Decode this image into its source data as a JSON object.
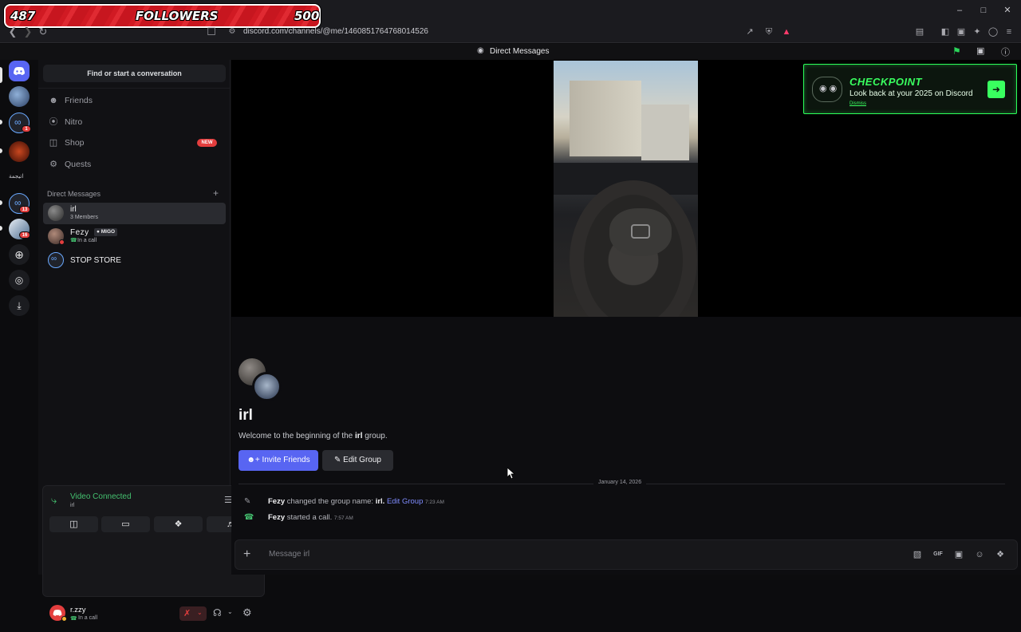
{
  "overlay": {
    "current": "487",
    "label": "FOLLOWERS",
    "goal": "500"
  },
  "browser": {
    "url": "discord.com/channels/@me/1460851764768014526"
  },
  "titlebar": {
    "title": "Direct Messages"
  },
  "server_rail": {
    "badges": [
      "1",
      "13",
      "16"
    ],
    "labels": [
      "اتيجمة"
    ]
  },
  "sidebar": {
    "search_placeholder": "Find or start a conversation",
    "nav": [
      {
        "label": "Friends",
        "icon": "friends-icon"
      },
      {
        "label": "Nitro",
        "icon": "nitro-icon"
      },
      {
        "label": "Shop",
        "icon": "shop-icon",
        "badge": "NEW"
      },
      {
        "label": "Quests",
        "icon": "quests-icon"
      }
    ],
    "dm_header": "Direct Messages",
    "dms": [
      {
        "name": "irl",
        "sub": "3 Members"
      },
      {
        "name": "Fezy",
        "tag": "MIGO",
        "sub": "In a call"
      },
      {
        "name": "STOP STORE"
      }
    ]
  },
  "voice": {
    "status": "Video Connected",
    "channel": "irl"
  },
  "user": {
    "name": "r.zzy",
    "status": "In a call"
  },
  "promo": {
    "title": "CHECKPOINT",
    "subtitle": "Look back at your 2025 on Discord",
    "dismiss": "Dismiss"
  },
  "welcome": {
    "title": "irl",
    "text_before": "Welcome to the beginning of the ",
    "text_bold": "irl",
    "text_after": " group.",
    "invite_label": "Invite Friends",
    "edit_label": "Edit Group"
  },
  "messages": {
    "date": "January 14, 2026",
    "items": [
      {
        "author": "Fezy",
        "text": "changed the group name: ",
        "value": "irl.",
        "link": "Edit Group",
        "time": "7:23 AM"
      },
      {
        "author": "Fezy",
        "text": "started a call.",
        "time": "7:57 AM"
      }
    ]
  },
  "composer": {
    "placeholder": "Message irl"
  },
  "colors": {
    "accent": "#5865f2",
    "green": "#44c06f",
    "promo_green": "#39ff5f",
    "red": "#e33e3e"
  }
}
